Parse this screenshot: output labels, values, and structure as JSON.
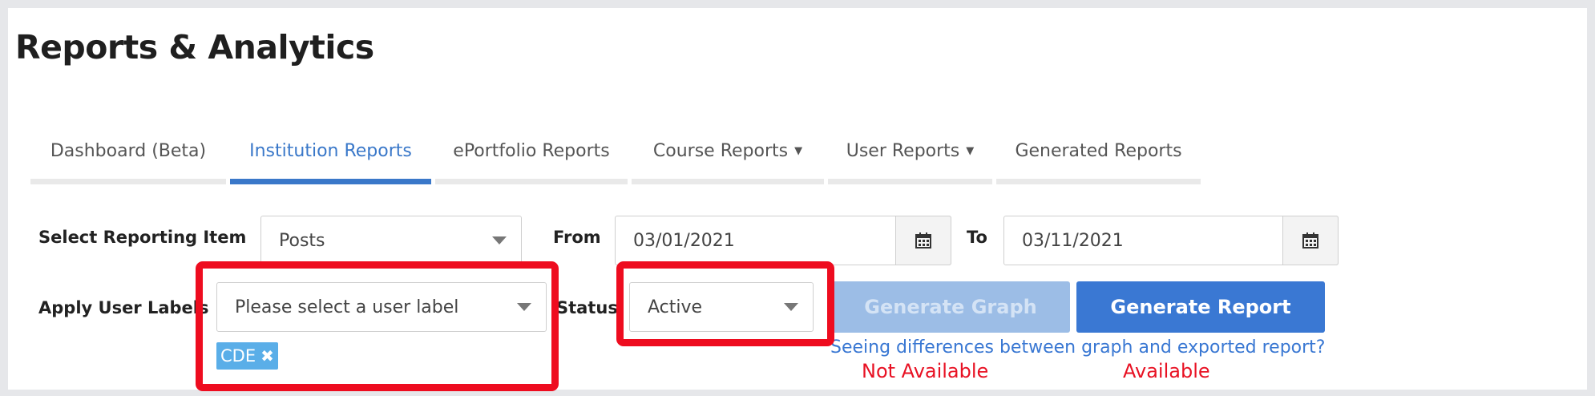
{
  "page": {
    "title": "Reports & Analytics"
  },
  "tabs": [
    {
      "label": "Dashboard (Beta)",
      "active": false,
      "has_caret": false
    },
    {
      "label": "Institution Reports",
      "active": true,
      "has_caret": false
    },
    {
      "label": "ePortfolio Reports",
      "active": false,
      "has_caret": false
    },
    {
      "label": "Course Reports",
      "active": false,
      "has_caret": true
    },
    {
      "label": "User Reports",
      "active": false,
      "has_caret": true
    },
    {
      "label": "Generated Reports",
      "active": false,
      "has_caret": false
    }
  ],
  "filters": {
    "reporting_item_label": "Select Reporting Item",
    "reporting_item_value": "Posts",
    "from_label": "From",
    "from_value": "03/01/2021",
    "to_label": "To",
    "to_value": "03/11/2021",
    "user_label_label": "Apply User Labels",
    "user_label_placeholder": "Please select a user label",
    "user_label_tags": [
      "CDE"
    ],
    "status_label": "Status",
    "status_value": "Active"
  },
  "actions": {
    "generate_graph": "Generate Graph",
    "generate_report": "Generate Report",
    "help_link": "Seeing differences between graph and exported report?"
  },
  "annotations": {
    "graph_note": "Not Available",
    "report_note": "Available",
    "highlight_color": "#ee0c1f"
  },
  "colors": {
    "accent": "#3a78c9",
    "primary_button": "#3a78d3",
    "disabled_button": "#9cbde6",
    "tag": "#5aaee8",
    "annotation_text": "#e81123"
  }
}
